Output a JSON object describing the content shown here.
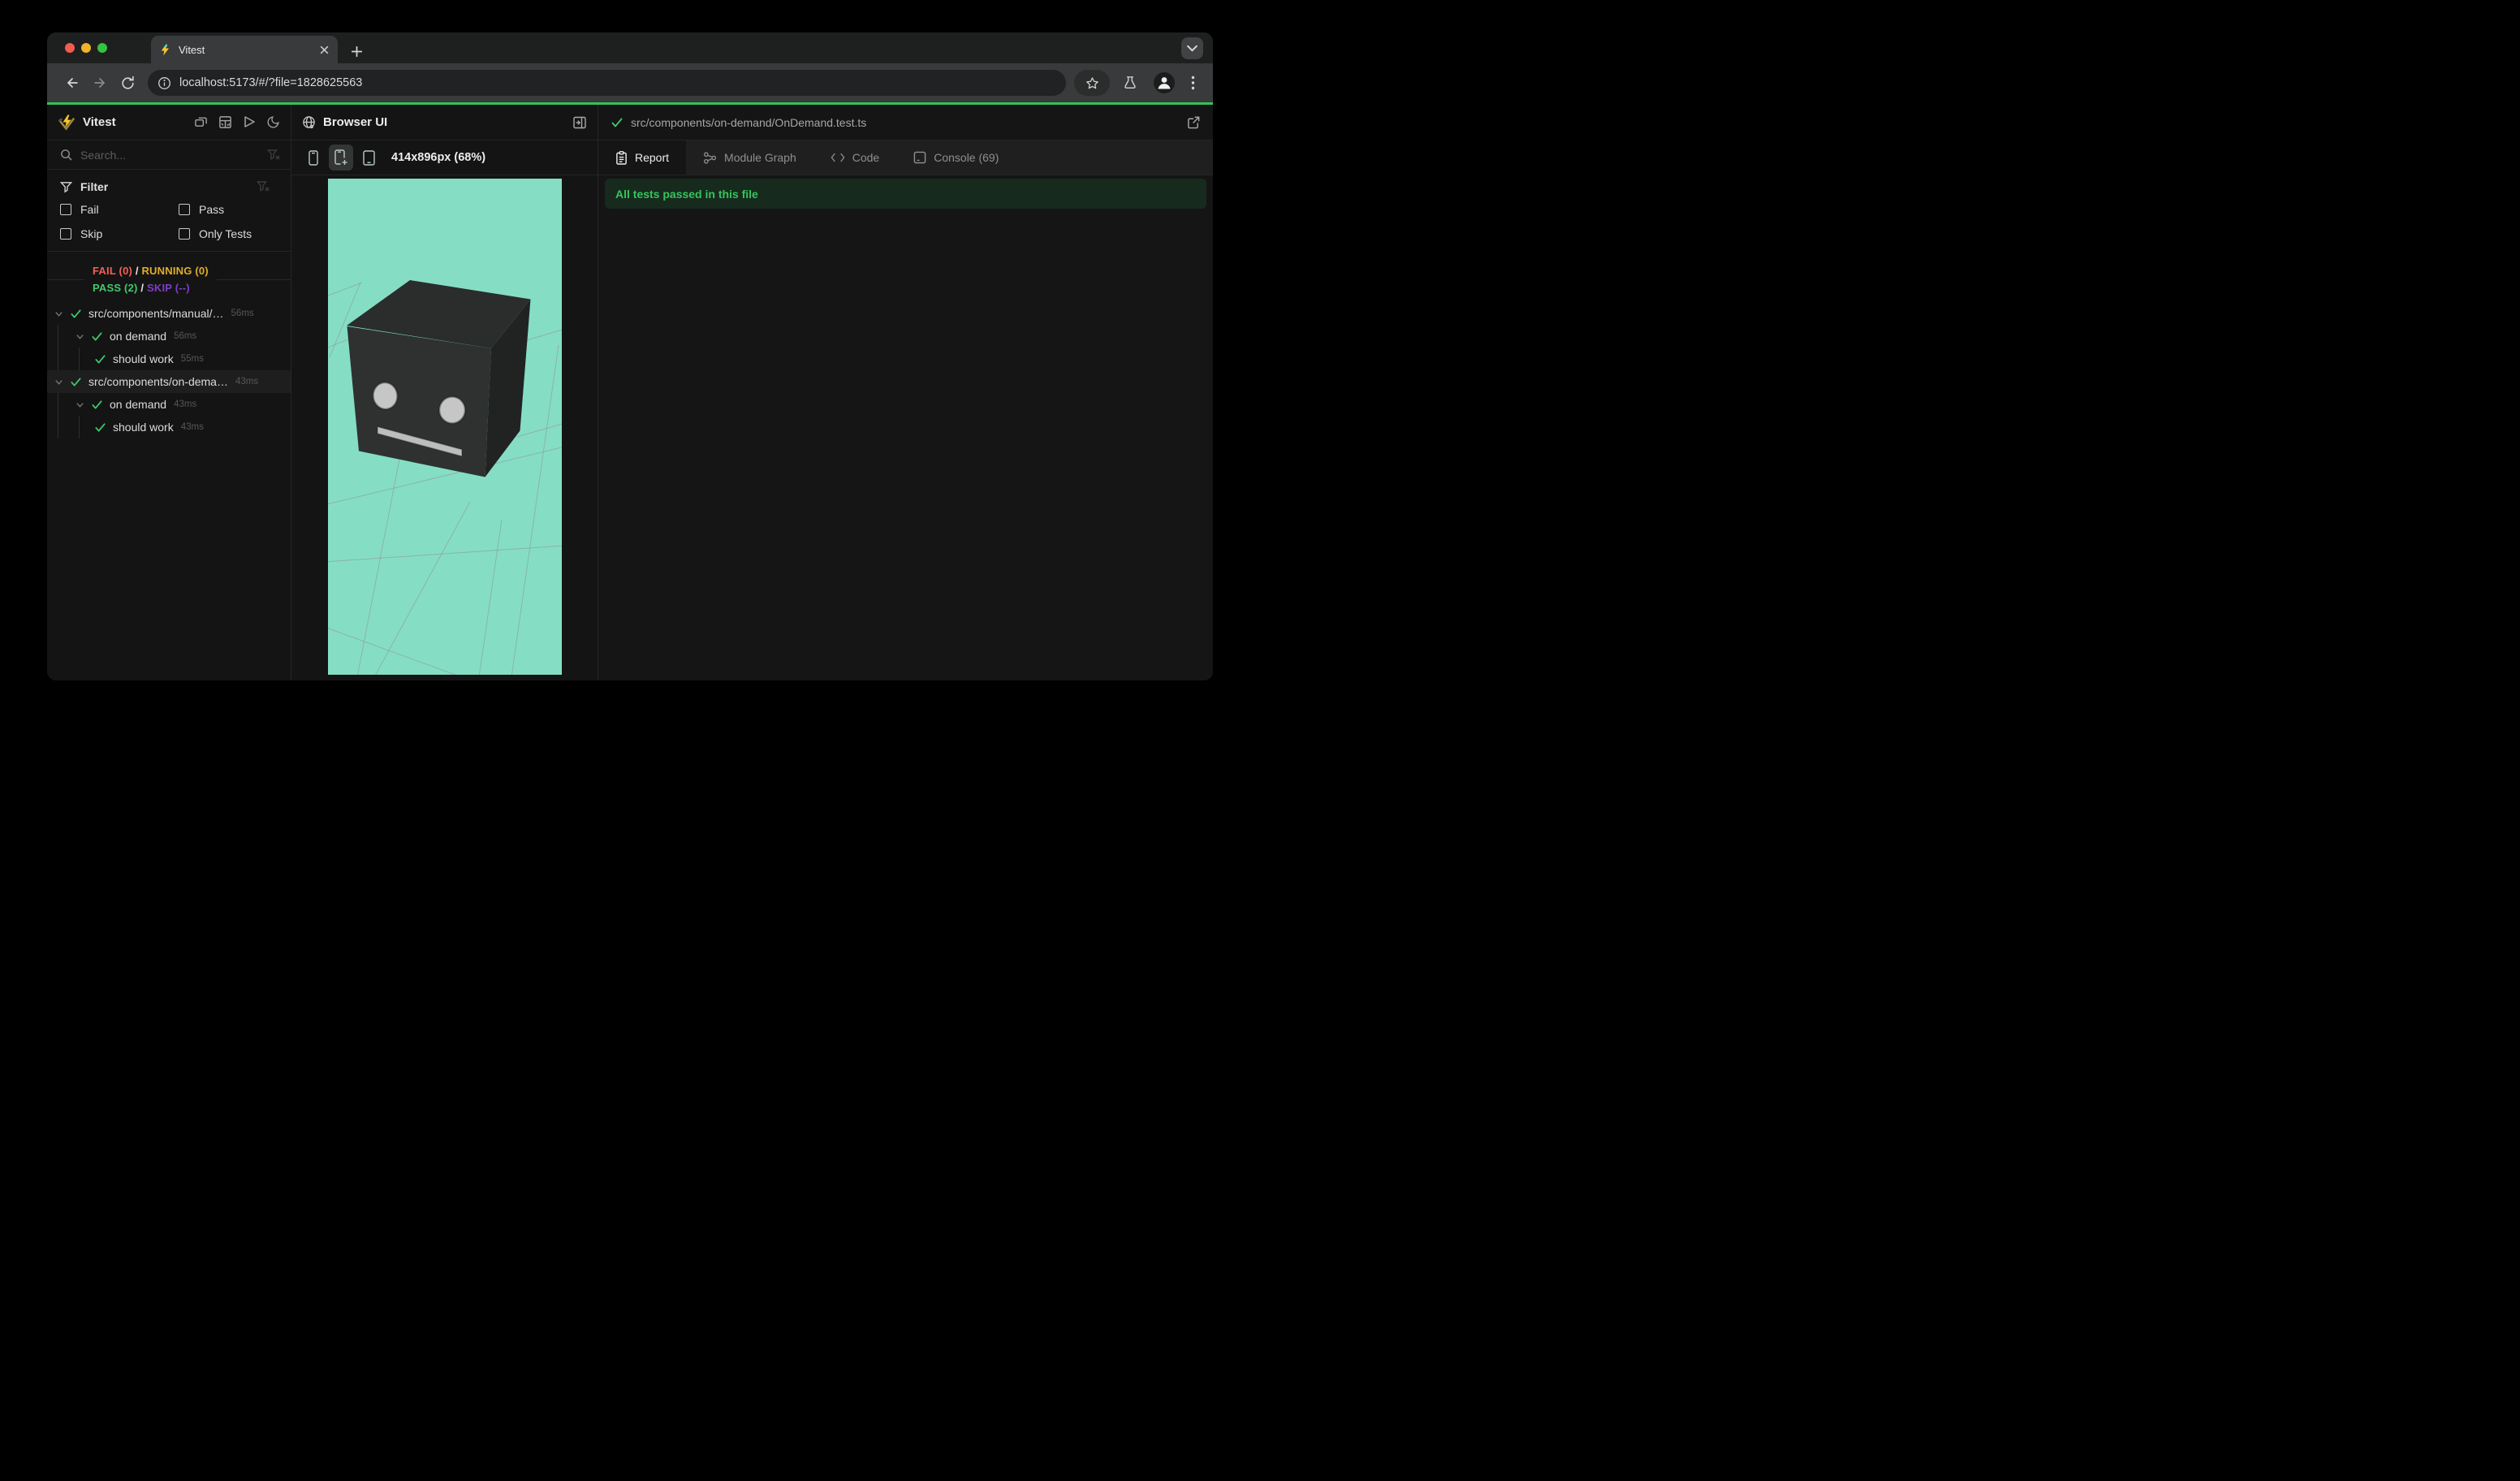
{
  "browser": {
    "tab_title": "Vitest",
    "url": "localhost:5173/#/?file=1828625563"
  },
  "sidebar": {
    "app_name": "Vitest",
    "search_placeholder": "Search...",
    "filter": {
      "title": "Filter",
      "options": [
        {
          "label": "Fail",
          "checked": false
        },
        {
          "label": "Pass",
          "checked": false
        },
        {
          "label": "Skip",
          "checked": false
        },
        {
          "label": "Only Tests",
          "checked": false
        }
      ]
    },
    "summary": {
      "fail_label": "FAIL (0)",
      "running_label": "RUNNING (0)",
      "pass_label": "PASS (2)",
      "skip_label": "SKIP (--)",
      "separator": "/"
    },
    "tree": [
      {
        "label": "src/components/manual/…",
        "duration": "56ms",
        "status": "pass",
        "depth": 0
      },
      {
        "label": "on demand",
        "duration": "56ms",
        "status": "pass",
        "depth": 1
      },
      {
        "label": "should work",
        "duration": "55ms",
        "status": "pass",
        "depth": 2
      },
      {
        "label": "src/components/on-dema…",
        "duration": "43ms",
        "status": "pass",
        "depth": 0,
        "selected": true
      },
      {
        "label": "on demand",
        "duration": "43ms",
        "status": "pass",
        "depth": 1
      },
      {
        "label": "should work",
        "duration": "43ms",
        "status": "pass",
        "depth": 2
      }
    ]
  },
  "browser_ui_panel": {
    "title": "Browser UI",
    "viewport_label": "414x896px (68%)",
    "canvas_background": "#85dec4"
  },
  "report_panel": {
    "file_path": "src/components/on-demand/OnDemand.test.ts",
    "tabs": [
      {
        "label": "Report",
        "active": true
      },
      {
        "label": "Module Graph",
        "active": false
      },
      {
        "label": "Code",
        "active": false
      },
      {
        "label": "Console (69)",
        "active": false
      }
    ],
    "banner": "All tests passed in this file"
  },
  "colors": {
    "progress_green": "#32c257",
    "pass_green": "#3fca6b",
    "fail_red": "#f26156",
    "running_amber": "#dfae2c",
    "skip_purple": "#7d3fc4",
    "banner_bg": "#162b1d",
    "banner_text": "#36c45c",
    "traffic_red": "#f35b51",
    "traffic_yellow": "#f0b32a",
    "traffic_green": "#35c23f"
  }
}
